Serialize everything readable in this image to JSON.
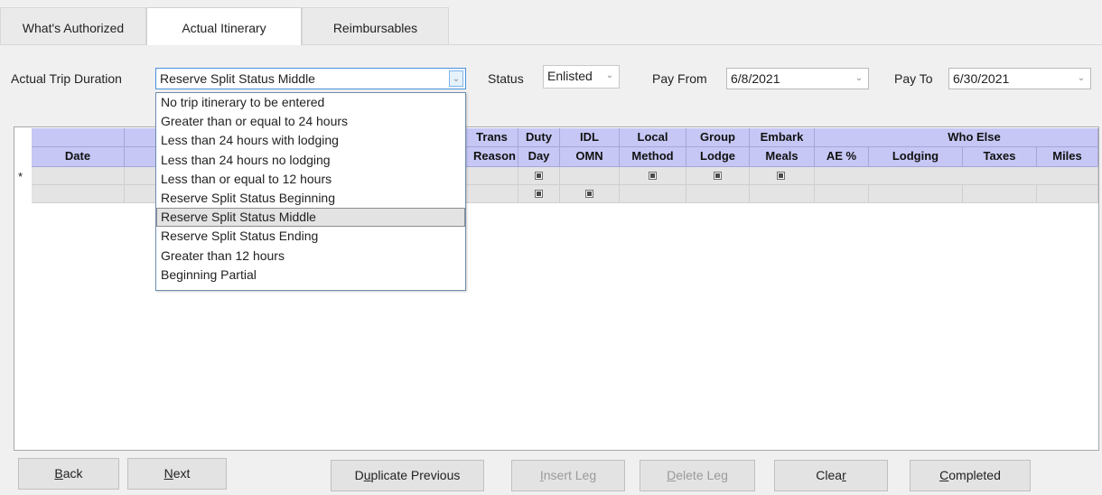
{
  "tabs": [
    {
      "label": "What's Authorized",
      "active": false
    },
    {
      "label": "Actual Itinerary",
      "active": true
    },
    {
      "label": "Reimbursables",
      "active": false
    }
  ],
  "form": {
    "duration_label": "Actual Trip Duration",
    "duration_value": "Reserve Split Status Middle",
    "status_label": "Status",
    "status_value": "Enlisted",
    "pay_from_label": "Pay From",
    "pay_from_value": "6/8/2021",
    "pay_to_label": "Pay To",
    "pay_to_value": "6/30/2021"
  },
  "dropdown": {
    "options": [
      "No trip itinerary to be entered",
      "Greater than or equal to 24 hours",
      "Less than 24 hours with lodging",
      "Less than 24 hours no lodging",
      "Less than or equal to 12 hours",
      "Reserve Split Status Beginning",
      "Reserve Split Status Middle",
      "Reserve Split Status Ending",
      "Greater than 12 hours",
      "Beginning Partial"
    ],
    "selected_index": 6
  },
  "grid": {
    "header_top": {
      "trans": "Trans",
      "duty": "Duty",
      "idl": "IDL",
      "local": "Local",
      "group": "Group",
      "embark": "Embark",
      "who_else": "Who Else"
    },
    "header_bottom": {
      "date": "Date",
      "reason": "Reason",
      "day": "Day",
      "omn": "OMN",
      "method": "Method",
      "lodge": "Lodge",
      "meals": "Meals",
      "ae_pct": "AE %",
      "lodging": "Lodging",
      "taxes": "Taxes",
      "miles": "Miles"
    },
    "new_row_marker": "*"
  },
  "buttons": {
    "back": {
      "pre": "",
      "key": "B",
      "post": "ack"
    },
    "next": {
      "pre": "",
      "key": "N",
      "post": "ext"
    },
    "duplicate": {
      "pre": "D",
      "key": "u",
      "post": "plicate Previous"
    },
    "insert": {
      "pre": "",
      "key": "I",
      "post": "nsert Leg"
    },
    "delete": {
      "pre": "",
      "key": "D",
      "post": "elete Leg"
    },
    "clear": {
      "pre": "Clea",
      "key": "r",
      "post": ""
    },
    "completed": {
      "pre": "",
      "key": "C",
      "post": "ompleted"
    }
  },
  "icons": {
    "combo_arrow": "chevron-down-icon",
    "checkbox": "checkbox-checked-icon"
  }
}
